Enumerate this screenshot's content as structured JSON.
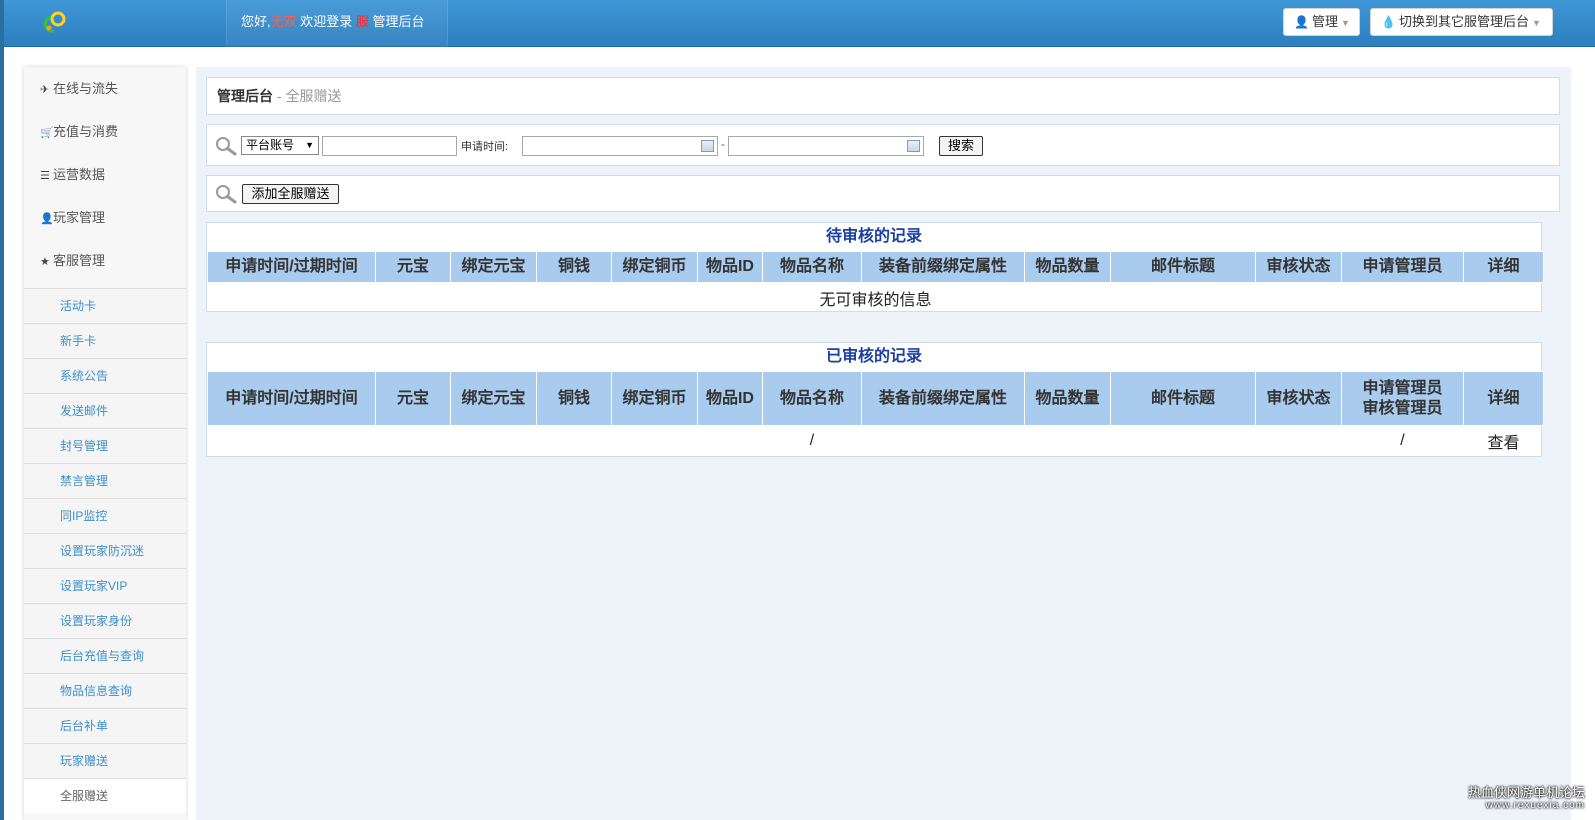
{
  "header": {
    "welcome_prefix": "您好,",
    "username": "无双",
    "welcome_mid": " 欢迎登录 ",
    "server": "服",
    "welcome_suffix": " 管理后台",
    "admin_label": "管理",
    "switch_label": "切换到其它服管理后台",
    "colors": {
      "bar": "#3f97d6",
      "username": "#ff5c4a"
    }
  },
  "sidebar": {
    "groups": [
      {
        "icon": "plane-icon",
        "label": "在线与流失"
      },
      {
        "icon": "cart-icon",
        "label": "充值与消费"
      },
      {
        "icon": "list-icon",
        "label": "运营数据"
      },
      {
        "icon": "user-icon",
        "label": "玩家管理"
      },
      {
        "icon": "star-icon",
        "label": "客服管理"
      }
    ],
    "items": [
      "活动卡",
      "新手卡",
      "系统公告",
      "发送邮件",
      "封号管理",
      "禁言管理",
      "同IP监控",
      "设置玩家防沉迷",
      "设置玩家VIP",
      "设置玩家身份",
      "后台充值与查询",
      "物品信息查询",
      "后台补单",
      "玩家赠送",
      "全服赠送"
    ],
    "active_item": "全服赠送"
  },
  "breadcrumb": {
    "main": "管理后台",
    "sub": " - 全服赠送"
  },
  "search": {
    "select_value": "平台账号",
    "account_value": "",
    "date_label": "申请时间:",
    "date_start": "",
    "date_end": "",
    "separator": "-",
    "button": "搜索"
  },
  "add": {
    "button": "添加全服赠送"
  },
  "pending": {
    "title": "待审核的记录",
    "headers": [
      "申请时间/过期时间",
      "元宝",
      "绑定元宝",
      "铜钱",
      "绑定铜币",
      "物品ID",
      "物品名称",
      "装备前缀绑定属性",
      "物品数量",
      "邮件标题",
      "审核状态",
      "申请管理员",
      "详细"
    ],
    "empty": "无可审核的信息"
  },
  "reviewed": {
    "title": "已审核的记录",
    "headers": [
      "申请时间/过期时间",
      "元宝",
      "绑定元宝",
      "铜钱",
      "绑定铜币",
      "物品ID",
      "物品名称",
      "装备前缀绑定属性",
      "物品数量",
      "邮件标题",
      "审核状态"
    ],
    "admin_header_line1": "申请管理员",
    "admin_header_line2": "审核管理员",
    "detail_header": "详细",
    "row": {
      "item_name": "/",
      "admins": "/",
      "view": "查看"
    }
  },
  "watermark": {
    "name": "热血侠网游单机论坛",
    "url": "www.rexuexia.com"
  }
}
